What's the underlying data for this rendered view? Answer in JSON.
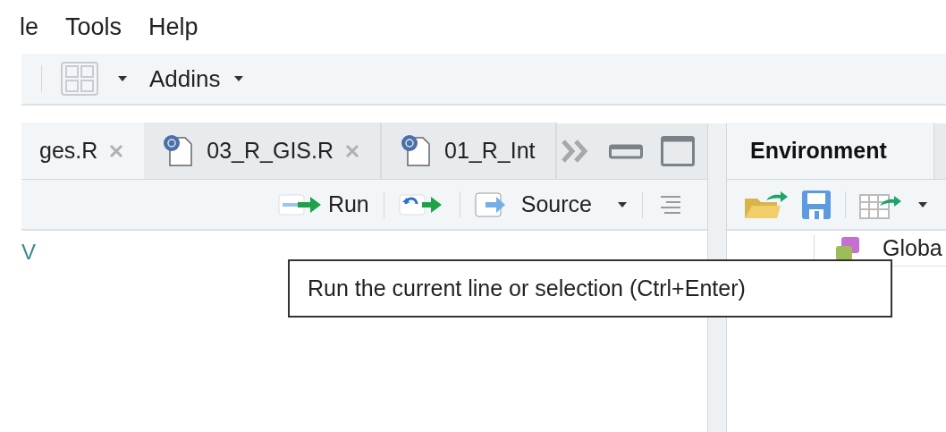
{
  "menu": [
    "le",
    "Tools",
    "Help"
  ],
  "toolbar": {
    "addins": "Addins"
  },
  "editor_tabs": [
    {
      "label": "ges.R",
      "selected": true,
      "file_icon": false,
      "close": true
    },
    {
      "label": "03_R_GIS.R",
      "selected": false,
      "file_icon": true,
      "close": true
    },
    {
      "label": "01_R_Int",
      "selected": false,
      "file_icon": true,
      "close": false
    }
  ],
  "editor_toolbar": {
    "run": "Run",
    "source": "Source"
  },
  "editor": {
    "line": "V"
  },
  "env_tabs": [
    {
      "label": "Environment",
      "selected": true
    }
  ],
  "env_scope": "Globa",
  "tooltip": "Run the current line or selection (Ctrl+Enter)"
}
